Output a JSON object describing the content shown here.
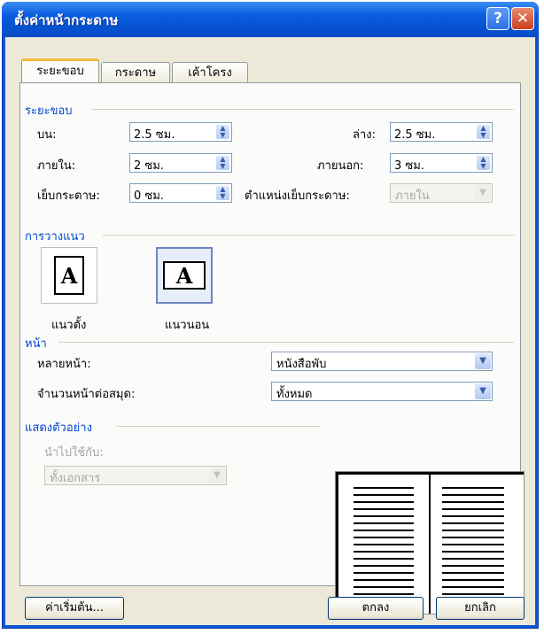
{
  "window": {
    "title": "ตั้งค่าหน้ากระดาษ",
    "help_glyph": "?",
    "close_glyph": "✕"
  },
  "tabs": [
    {
      "label": "ระยะขอบ",
      "active": true
    },
    {
      "label": "กระดาษ",
      "active": false
    },
    {
      "label": "เค้าโครง",
      "active": false
    }
  ],
  "margins": {
    "group_label": "ระยะขอบ",
    "top": {
      "label": "บน:",
      "value": "2.5 ซม."
    },
    "bottom": {
      "label": "ล่าง:",
      "value": "2.5 ซม."
    },
    "inside": {
      "label": "ภายใน:",
      "value": "2 ซม."
    },
    "outside": {
      "label": "ภายนอก:",
      "value": "3 ซม."
    },
    "gutter": {
      "label": "เย็บกระดาษ:",
      "value": "0 ซม."
    },
    "gutter_position": {
      "label": "ตำแหน่งเย็บกระดาษ:",
      "value": "ภายใน"
    }
  },
  "orientation": {
    "group_label": "การวางแนว",
    "portrait": {
      "label": "แนวตั้ง",
      "glyph": "A"
    },
    "landscape": {
      "label": "แนวนอน",
      "glyph": "A",
      "selected": true
    }
  },
  "pages": {
    "group_label": "หน้า",
    "multiple_pages": {
      "label": "หลายหน้า:",
      "value": "หนังสือพับ"
    },
    "sheets_per_booklet": {
      "label": "จำนวนหน้าต่อสมุด:",
      "value": "ทั้งหมด"
    }
  },
  "preview": {
    "group_label": "แสดงตัวอย่าง",
    "apply_to": {
      "label": "นำไปใช้กับ:",
      "value": "ทั้งเอกสาร"
    }
  },
  "buttons": {
    "default": "ค่าเริ่มต้น...",
    "ok": "ตกลง",
    "cancel": "ยกเลิก"
  },
  "colors": {
    "title_bar": "#0552d2",
    "group_label": "#0046d5",
    "dialog_bg": "#ece9d8"
  }
}
